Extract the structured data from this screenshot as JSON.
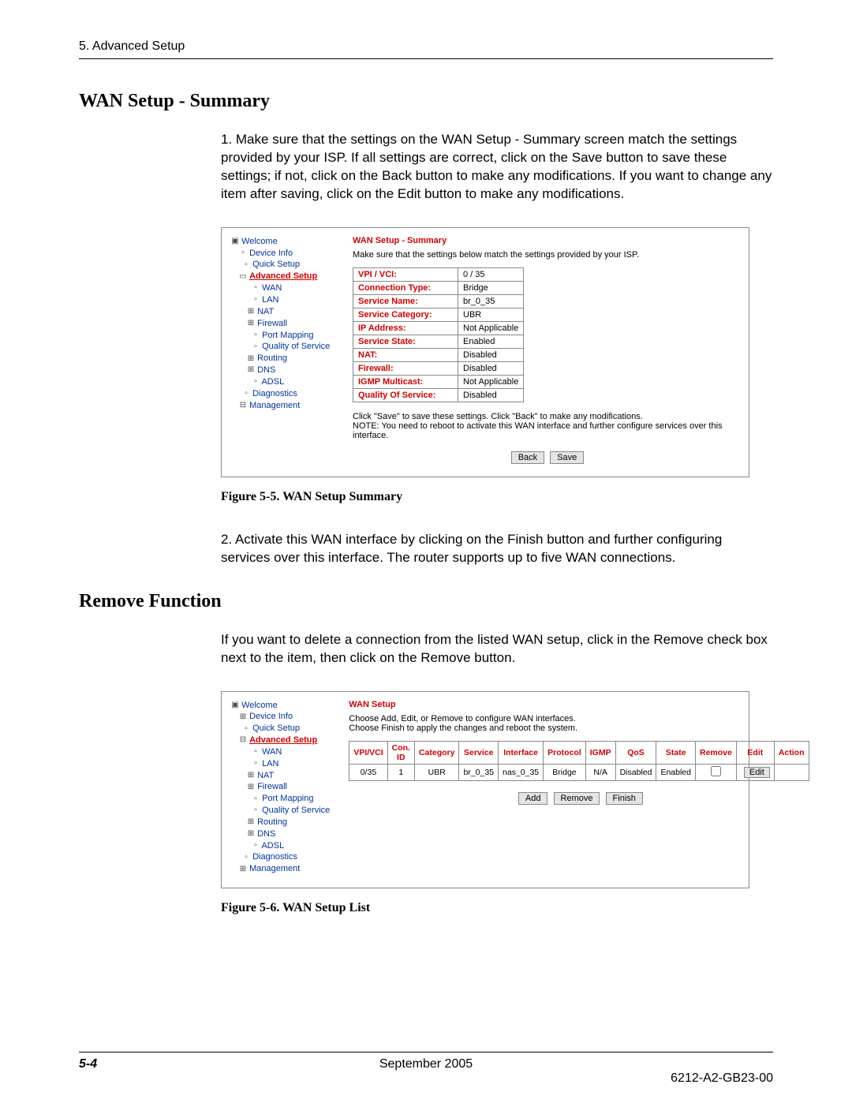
{
  "doc": {
    "chapter_header": "5. Advanced Setup",
    "section1_title": "WAN Setup - Summary",
    "para1": "1. Make sure that the settings on the WAN Setup - Summary screen match the settings provided by your ISP. If all settings are correct, click on the Save button to save these settings; if not, click on the Back button to make any modifications. If you want to change any item after saving, click on the Edit button to make any modifications.",
    "fig5_caption": "Figure 5-5.    WAN Setup Summary",
    "para2": "2. Activate this WAN interface by clicking on the Finish button and further configuring services over this interface. The router supports up to five WAN connections.",
    "section2_title": "Remove Function",
    "para3": "If you want to delete a connection from the listed WAN setup, click in the Remove check box next to the item, then click on the Remove button.",
    "fig6_caption": "Figure 5-6.    WAN Setup List",
    "footer_page": "5-4",
    "footer_center": "September 2005",
    "footer_right": "6212-A2-GB23-00"
  },
  "nav1": {
    "welcome": "Welcome",
    "device_info": "Device Info",
    "quick_setup": "Quick Setup",
    "advanced_setup": "Advanced Setup",
    "wan": "WAN",
    "lan": "LAN",
    "nat": "NAT",
    "firewall": "Firewall",
    "port_mapping": "Port Mapping",
    "qos": "Quality of Service",
    "routing": "Routing",
    "dns": "DNS",
    "adsl": "ADSL",
    "diagnostics": "Diagnostics",
    "management": "Management"
  },
  "shot1": {
    "title": "WAN Setup - Summary",
    "instruction": "Make sure that the settings below match the settings provided by your ISP.",
    "rows": {
      "vpi_vci_k": "VPI / VCI:",
      "vpi_vci_v": "0 / 35",
      "conn_type_k": "Connection Type:",
      "conn_type_v": "Bridge",
      "service_name_k": "Service Name:",
      "service_name_v": "br_0_35",
      "service_cat_k": "Service Category:",
      "service_cat_v": "UBR",
      "ip_k": "IP Address:",
      "ip_v": "Not Applicable",
      "state_k": "Service State:",
      "state_v": "Enabled",
      "nat_k": "NAT:",
      "nat_v": "Disabled",
      "fw_k": "Firewall:",
      "fw_v": "Disabled",
      "igmp_k": "IGMP Multicast:",
      "igmp_v": "Not Applicable",
      "qos_k": "Quality Of Service:",
      "qos_v": "Disabled"
    },
    "note1": "Click \"Save\" to save these settings. Click \"Back\" to make any modifications.",
    "note2": "NOTE: You need to reboot to activate this WAN interface and further configure services over this interface.",
    "back_btn": "Back",
    "save_btn": "Save"
  },
  "shot2": {
    "title": "WAN Setup",
    "line1": "Choose Add, Edit, or Remove to configure WAN interfaces.",
    "line2": "Choose Finish to apply the changes and reboot the system.",
    "headers": {
      "vpivci": "VPI/VCI",
      "conid": "Con. ID",
      "category": "Category",
      "service": "Service",
      "interface": "Interface",
      "protocol": "Protocol",
      "igmp": "IGMP",
      "qos": "QoS",
      "state": "State",
      "remove": "Remove",
      "edit": "Edit",
      "action": "Action"
    },
    "row": {
      "vpivci": "0/35",
      "conid": "1",
      "category": "UBR",
      "service": "br_0_35",
      "interface": "nas_0_35",
      "protocol": "Bridge",
      "igmp": "N/A",
      "qos": "Disabled",
      "state": "Enabled",
      "edit_btn": "Edit"
    },
    "add_btn": "Add",
    "remove_btn": "Remove",
    "finish_btn": "Finish"
  }
}
